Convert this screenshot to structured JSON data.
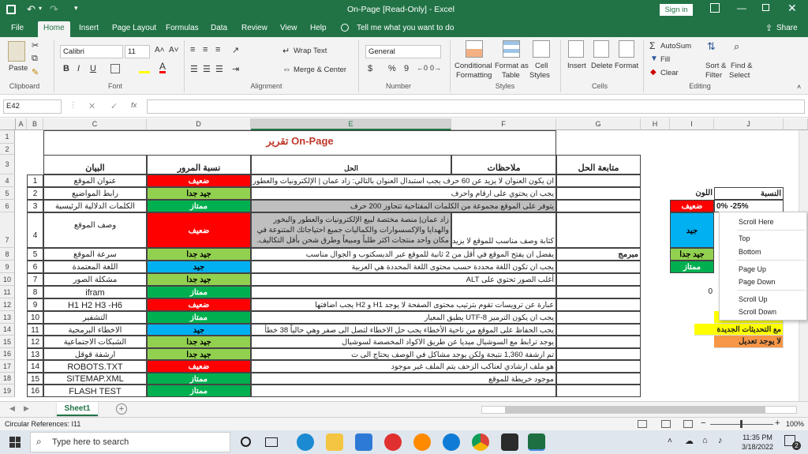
{
  "titlebar": {
    "title": "On-Page  [Read-Only]  -  Excel",
    "signin": "Sign in"
  },
  "tabs": [
    "File",
    "Home",
    "Insert",
    "Page Layout",
    "Formulas",
    "Data",
    "Review",
    "View",
    "Help",
    "Tell me what you want to do",
    "Share"
  ],
  "ribbon": {
    "clipboard": {
      "paste": "Paste",
      "label": "Clipboard"
    },
    "font": {
      "name": "Calibri",
      "size": "11",
      "label": "Font",
      "bold": "B",
      "italic": "I",
      "underline": "U"
    },
    "alignment": {
      "wrap": "Wrap Text",
      "merge": "Merge & Center",
      "label": "Alignment"
    },
    "number": {
      "format": "General",
      "currency": "$",
      "percent": "%",
      "comma": "9",
      "label": "Number"
    },
    "styles": {
      "conditional": "Conditional",
      "conditional2": "Formatting",
      "formatas": "Format as",
      "formatas2": "Table",
      "cell": "Cell",
      "cell2": "Styles",
      "label": "Styles"
    },
    "cells": {
      "insert": "Insert",
      "delete": "Delete",
      "format": "Format",
      "label": "Cells"
    },
    "editing": {
      "autosum": "AutoSum",
      "fill": "Fill",
      "clear": "Clear",
      "sort": "Sort &",
      "sort2": "Filter",
      "find": "Find &",
      "find2": "Select",
      "label": "Editing"
    }
  },
  "formulabar": {
    "namebox": "E42",
    "fx": "fx",
    "value": ""
  },
  "columns": [
    "A",
    "B",
    "C",
    "D",
    "E",
    "F",
    "G",
    "H",
    "I",
    "J"
  ],
  "rows": [
    "1",
    "2",
    "3",
    "4",
    "5",
    "6",
    "7",
    "8",
    "9",
    "10",
    "11",
    "12",
    "13",
    "14",
    "15",
    "16",
    "17",
    "18",
    "19"
  ],
  "sheet": {
    "title": "تقرير On-Page",
    "headers": {
      "c": "البيان",
      "d": "نسبة المرور",
      "e": "الحل",
      "f": "ملاحظات",
      "g": "متابعة الحل"
    },
    "r4": {
      "b": "1",
      "c": "عنوان الموقع",
      "d": "ضعيف",
      "e": "ان يكون العنوان لا يزيد عن 60 حرف يجب استبدال العنوان بالتالي: زاد عمان | الإلكترونيات والعطور والب"
    },
    "r5": {
      "b": "2",
      "c": "رابط المواضيع",
      "d": "جيد جدا",
      "e": "يجب ان يحتوي على ارقام واحرف"
    },
    "r6": {
      "b": "3",
      "c": "الكلمات الدلالية الرئيسية",
      "d": "ممتاز",
      "e": "يتوفر على الموقع مجموعة من الكلمات المفتاحية تتجاوز 200 حرف"
    },
    "r7": {
      "b": "4",
      "c": "وصف الموقع",
      "d": "ضعيف",
      "e1": "زاد عمان| منصة مختصة لبيع الإلكترونيات والعطور والبخور",
      "e2": "والهدايا والإكسسوارات والكماليات جميع احتياجاتك المتنوعة في",
      "e3": "مكان واحد منتجات اكثر طلباً ومبيعاً وطرق شحن بأقل التكاليف.",
      "f": "كتابة وصف مناسب للموقع لا يزيد"
    },
    "r8": {
      "b": "5",
      "c": "سرعة الموقع",
      "d": "جيد جدا",
      "e": "يفضل ان يفتح الموقع في أقل من 2 ثانية للموقع عبر الديسكتوب و الجوال مناسب",
      "h": "مبرمج"
    },
    "r9": {
      "b": "6",
      "c": "اللغة المعتمدة",
      "d": "جيد",
      "e": "يجب ان تكون اللغة محددة حسب محتوى اللغة المحددة هي العربية"
    },
    "r10": {
      "b": "7",
      "c": "مشكلة الصور",
      "d": "جيد جدا",
      "e": "أغلب الصور تحتوي على ALT"
    },
    "r11": {
      "b": "8",
      "c": "ifram",
      "d": "ممتاز",
      "i": "0"
    },
    "r12": {
      "b": "9",
      "c": "H1 H2 H3 -H6",
      "d": "ضعيف",
      "e": "عبارة عن ترويسات تقوم بترتيب محتوى الصفحة لا يوجد H1 و H2 يجب اضافتها"
    },
    "r13": {
      "b": "10",
      "c": "التشفير",
      "d": "ممتاز",
      "e": "يجب ان يكون الترميز UTF-8 يطبق المعيار"
    },
    "r14": {
      "b": "11",
      "c": "الاخطاء البرمجية",
      "d": "جيد",
      "e": "يجب الحفاظ على الموقع من ناحية الأخطاء يجب حل الاخطاء لتصل الى صفر وهي حالياً 38 خطأ"
    },
    "r15": {
      "b": "12",
      "c": "الشبكات الاجتماعية",
      "d": "جيد جدا",
      "e": "يوجد ترابط مع السوشيال ميديا عن طريق  الاكواد المخصصة لسوشيال"
    },
    "r16": {
      "b": "13",
      "c": "ارشفة قوقل",
      "d": "جيد جدا",
      "e": "تم ارشفة 1,360 نتيجة ولكن يوجد مشاكل في الوصف يحتاج الى ت"
    },
    "r17": {
      "b": "14",
      "c": "ROBOTS.TXT",
      "d": "ضعيف",
      "e": "هو ملف ارشادي لعناكب الزحف يتم الملف غير موجود"
    },
    "r18": {
      "b": "15",
      "c": "SITEMAP.XML",
      "d": "ممتاز",
      "e": "موجود خريطة للموقع"
    },
    "r19": {
      "b": "16",
      "c": "FLASH TEST",
      "d": "ممتاز"
    },
    "legend": {
      "ratio": "النسبة",
      "color": "اللون",
      "weak": "ضعيف",
      "weak_val": "0% -25%",
      "good": "جيد",
      "vgood": "جيد جدا",
      "excellent": "ممتاز",
      "updates": "مع التحديثات الجديدة",
      "nochange": "لا يوجد تعديل"
    }
  },
  "context_menu": [
    "Scroll Here",
    "Top",
    "Bottom",
    "Page Up",
    "Page Down",
    "Scroll Up",
    "Scroll Down"
  ],
  "sheetbar": {
    "tab": "Sheet1",
    "add": "+"
  },
  "statusbar": {
    "text": "Circular References: I11",
    "zoom": "100%"
  },
  "taskbar": {
    "search": "Type here to search",
    "time": "11:35 PM",
    "date": "3/18/2022",
    "notif": "2"
  }
}
